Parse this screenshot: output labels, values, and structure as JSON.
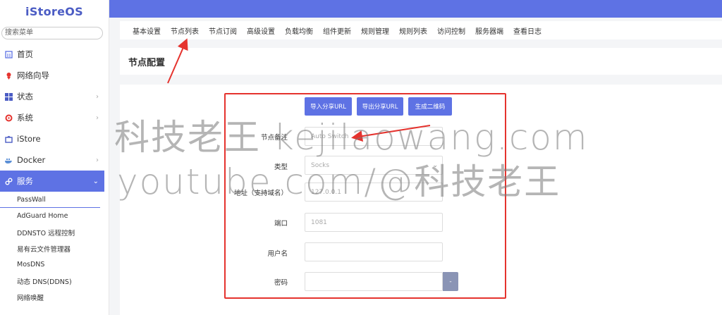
{
  "brand": "iStoreOS",
  "search": {
    "placeholder": "搜索菜单"
  },
  "sidebar": {
    "items": [
      {
        "label": "首页",
        "icon": "home-icon",
        "chev": false
      },
      {
        "label": "网络向导",
        "icon": "wizard-icon",
        "chev": false
      },
      {
        "label": "状态",
        "icon": "status-icon",
        "chev": true
      },
      {
        "label": "系统",
        "icon": "gear-icon",
        "chev": true
      },
      {
        "label": "iStore",
        "icon": "store-icon",
        "chev": false
      },
      {
        "label": "Docker",
        "icon": "docker-icon",
        "chev": true
      },
      {
        "label": "服务",
        "icon": "services-icon",
        "chev": true,
        "active": true
      }
    ],
    "sub_items": [
      "PassWall",
      "AdGuard Home",
      "DDNSTO 远程控制",
      "易有云文件管理器",
      "MosDNS",
      "动态 DNS(DDNS)",
      "网络唤醒"
    ]
  },
  "tabs": [
    "基本设置",
    "节点列表",
    "节点订阅",
    "高级设置",
    "负载均衡",
    "组件更新",
    "规则管理",
    "规则列表",
    "访问控制",
    "服务器端",
    "查看日志"
  ],
  "section_title": "节点配置",
  "buttons": {
    "import": "导入分享URL",
    "export": "导出分享URL",
    "qrcode": "生成二维码"
  },
  "form": {
    "remark_label": "节点备注",
    "remark_value": "Auto Switch",
    "type_label": "类型",
    "type_value": "Socks",
    "address_label": "地址（支持域名）",
    "address_value": "127.0.0.1",
    "port_label": "端口",
    "port_value": "1081",
    "username_label": "用户名",
    "username_value": "",
    "password_label": "密码",
    "password_value": "",
    "password_toggle": "-"
  },
  "watermark": {
    "line1": "科技老王 kejilaowang.com",
    "line2": "youtube.com/@科技老王"
  },
  "colors": {
    "accent": "#5e72e4",
    "annotation": "#e5332e"
  }
}
